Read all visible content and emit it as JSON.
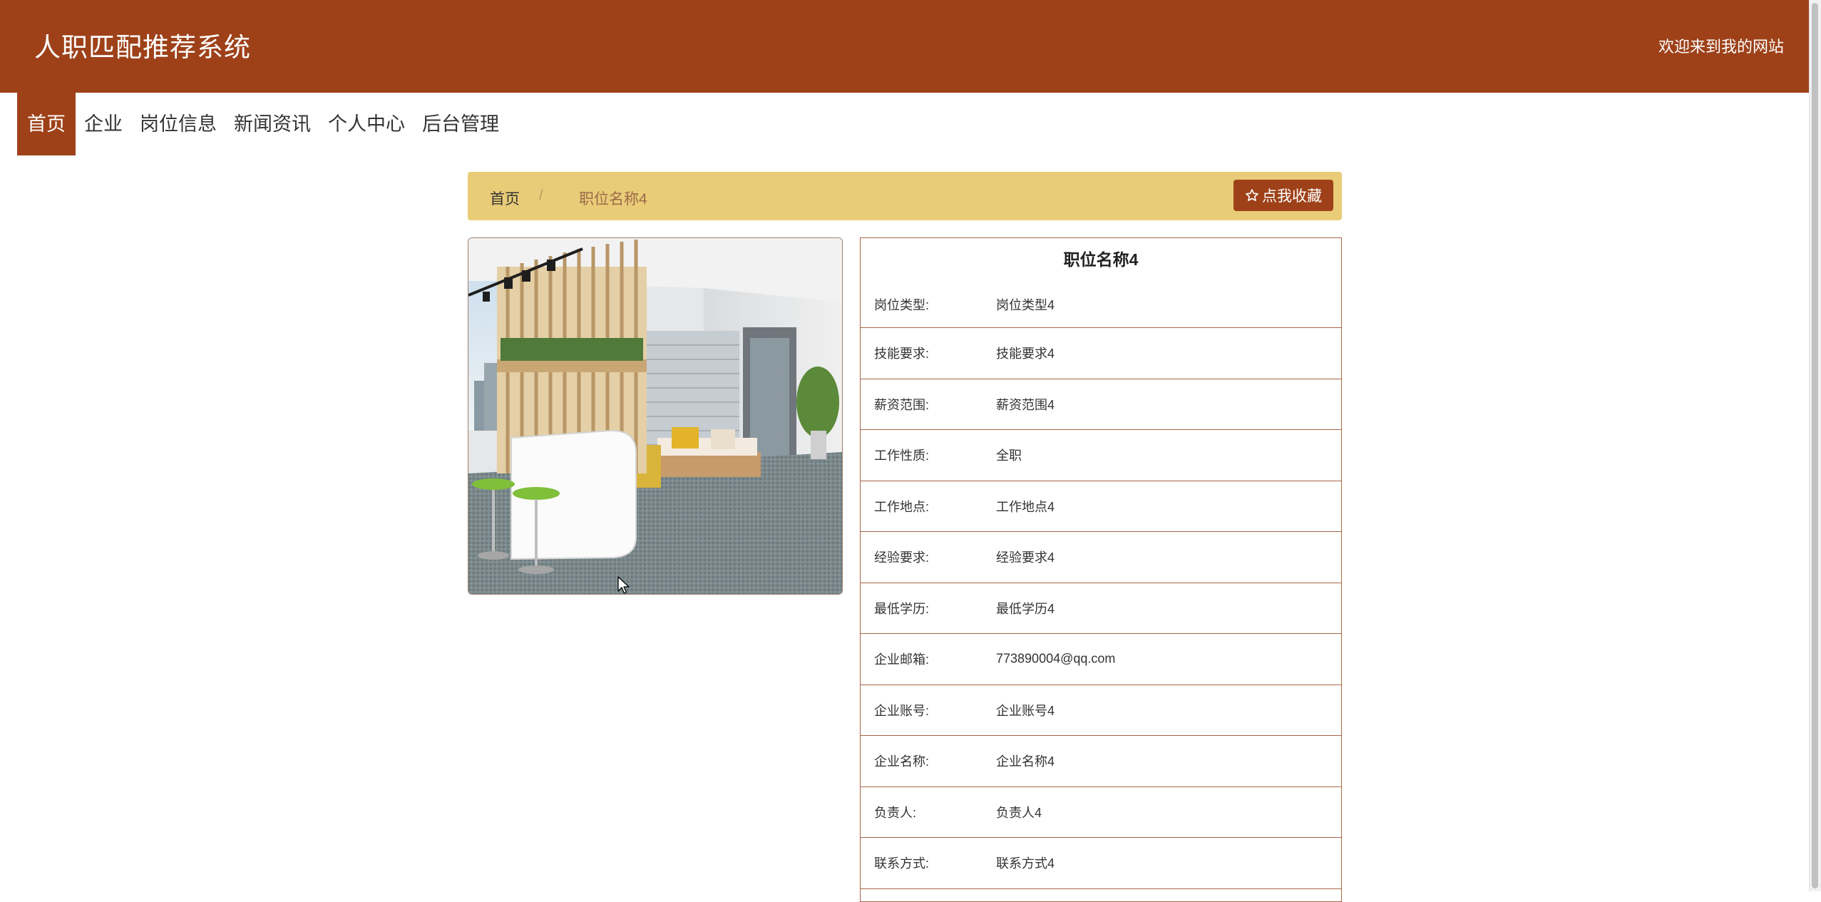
{
  "header": {
    "site_title": "人职匹配推荐系统",
    "welcome": "欢迎来到我的网站"
  },
  "nav": {
    "items": [
      "首页",
      "企业",
      "岗位信息",
      "新闻资讯",
      "个人中心",
      "后台管理"
    ],
    "active": "首页"
  },
  "breadcrumb": {
    "home": "首页",
    "separator": "/",
    "current": "职位名称4"
  },
  "favorite_button": {
    "label": "点我收藏",
    "icon": "star-outline-icon"
  },
  "detail": {
    "title": "职位名称4",
    "fields": [
      {
        "label": "岗位类型:",
        "value": "岗位类型4"
      },
      {
        "label": "技能要求:",
        "value": "技能要求4"
      },
      {
        "label": "薪资范围:",
        "value": "薪资范围4"
      },
      {
        "label": "工作性质:",
        "value": "全职"
      },
      {
        "label": "工作地点:",
        "value": "工作地点4"
      },
      {
        "label": "经验要求:",
        "value": "经验要求4"
      },
      {
        "label": "最低学历:",
        "value": "最低学历4"
      },
      {
        "label": "企业邮箱:",
        "value": "773890004@qq.com"
      },
      {
        "label": "企业账号:",
        "value": "企业账号4"
      },
      {
        "label": "企业名称:",
        "value": "企业名称4"
      },
      {
        "label": "负责人:",
        "value": "负责人4"
      },
      {
        "label": "联系方式:",
        "value": "联系方式4"
      }
    ]
  },
  "colors": {
    "brand": "#9e4119",
    "breadcrumb_bg": "#e8cc77",
    "border": "#a86446"
  }
}
